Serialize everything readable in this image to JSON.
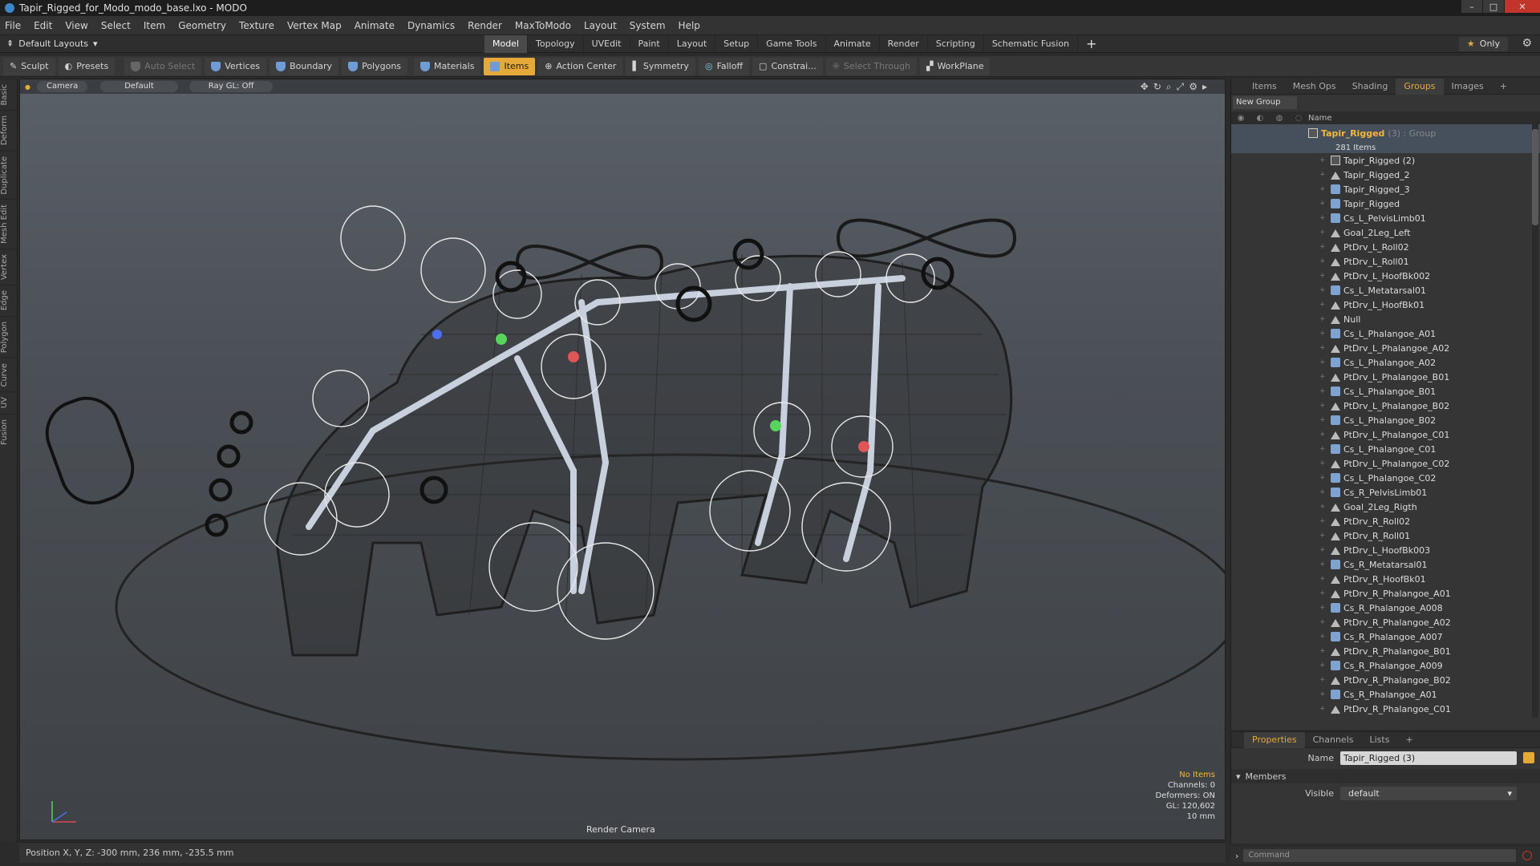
{
  "window": {
    "title": "Tapir_Rigged_for_Modo_modo_base.lxo - MODO",
    "controls": [
      "–",
      "□",
      "✕"
    ]
  },
  "menu": [
    "File",
    "Edit",
    "View",
    "Select",
    "Item",
    "Geometry",
    "Texture",
    "Vertex Map",
    "Animate",
    "Dynamics",
    "Render",
    "MaxToModo",
    "Layout",
    "System",
    "Help"
  ],
  "layoutbar": {
    "layouts_label": "Default Layouts",
    "tabs": [
      "Model",
      "Topology",
      "UVEdit",
      "Paint",
      "Layout",
      "Setup",
      "Game Tools",
      "Animate",
      "Render",
      "Scripting",
      "Schematic Fusion"
    ],
    "active_tab": "Model",
    "plus": "+",
    "only_label": "Only"
  },
  "toolbar": {
    "sculpt": "Sculpt",
    "presets": "Presets",
    "auto_select": "Auto Select",
    "vertices": "Vertices",
    "boundary": "Boundary",
    "polygons": "Polygons",
    "materials": "Materials",
    "items": "Items",
    "action_center": "Action Center",
    "symmetry": "Symmetry",
    "falloff": "Falloff",
    "constrain": "Constrai...",
    "select_through": "Select Through",
    "workplane": "WorkPlane"
  },
  "left_tabs": [
    "Basic",
    "Deform",
    "Duplicate",
    "Mesh Edit",
    "Vertex",
    "Edge",
    "Polygon",
    "Curve",
    "UV",
    "Fusion"
  ],
  "viewport": {
    "camera": "Camera",
    "shading": "Default",
    "raygl": "Ray GL: Off",
    "info": {
      "selection": "No Items",
      "channels": "Channels: 0",
      "deformers": "Deformers: ON",
      "gl": "GL: 120,602",
      "scale": "10 mm"
    },
    "render_camera": "Render Camera"
  },
  "status": {
    "position": "Position X, Y, Z:  -300 mm, 236 mm, -235.5 mm"
  },
  "right_panel": {
    "tabs": [
      "Items",
      "Mesh Ops",
      "Shading",
      "Groups",
      "Images"
    ],
    "active_tab": "Groups",
    "plus": "+",
    "new_group": "New Group",
    "column_name": "Name",
    "group": {
      "name": "Tapir_Rigged",
      "suffix": "(3) : Group",
      "count": "281 Items"
    },
    "items": [
      {
        "name": "Tapir_Rigged (2)",
        "type": "group"
      },
      {
        "name": "Tapir_Rigged_2",
        "type": "locator"
      },
      {
        "name": "Tapir_Rigged_3",
        "type": "mesh"
      },
      {
        "name": "Tapir_Rigged",
        "type": "mesh"
      },
      {
        "name": "Cs_L_PelvisLimb01",
        "type": "mesh"
      },
      {
        "name": "Goal_2Leg_Left",
        "type": "locator"
      },
      {
        "name": "PtDrv_L_Roll02",
        "type": "locator"
      },
      {
        "name": "PtDrv_L_Roll01",
        "type": "locator"
      },
      {
        "name": "PtDrv_L_HoofBk002",
        "type": "locator"
      },
      {
        "name": "Cs_L_Metatarsal01",
        "type": "mesh"
      },
      {
        "name": "PtDrv_L_HoofBk01",
        "type": "locator"
      },
      {
        "name": "Null",
        "type": "locator"
      },
      {
        "name": "Cs_L_Phalangoe_A01",
        "type": "mesh"
      },
      {
        "name": "PtDrv_L_Phalangoe_A02",
        "type": "locator"
      },
      {
        "name": "Cs_L_Phalangoe_A02",
        "type": "mesh"
      },
      {
        "name": "PtDrv_L_Phalangoe_B01",
        "type": "locator"
      },
      {
        "name": "Cs_L_Phalangoe_B01",
        "type": "mesh"
      },
      {
        "name": "PtDrv_L_Phalangoe_B02",
        "type": "locator"
      },
      {
        "name": "Cs_L_Phalangoe_B02",
        "type": "mesh"
      },
      {
        "name": "PtDrv_L_Phalangoe_C01",
        "type": "locator"
      },
      {
        "name": "Cs_L_Phalangoe_C01",
        "type": "mesh"
      },
      {
        "name": "PtDrv_L_Phalangoe_C02",
        "type": "locator"
      },
      {
        "name": "Cs_L_Phalangoe_C02",
        "type": "mesh"
      },
      {
        "name": "Cs_R_PelvisLimb01",
        "type": "mesh"
      },
      {
        "name": "Goal_2Leg_Rigth",
        "type": "locator"
      },
      {
        "name": "PtDrv_R_Roll02",
        "type": "locator"
      },
      {
        "name": "PtDrv_R_Roll01",
        "type": "locator"
      },
      {
        "name": "PtDrv_L_HoofBk003",
        "type": "locator"
      },
      {
        "name": "Cs_R_Metatarsal01",
        "type": "mesh"
      },
      {
        "name": "PtDrv_R_HoofBk01",
        "type": "locator"
      },
      {
        "name": "PtDrv_R_Phalangoe_A01",
        "type": "locator"
      },
      {
        "name": "Cs_R_Phalangoe_A008",
        "type": "mesh"
      },
      {
        "name": "PtDrv_R_Phalangoe_A02",
        "type": "locator"
      },
      {
        "name": "Cs_R_Phalangoe_A007",
        "type": "mesh"
      },
      {
        "name": "PtDrv_R_Phalangoe_B01",
        "type": "locator"
      },
      {
        "name": "Cs_R_Phalangoe_A009",
        "type": "mesh"
      },
      {
        "name": "PtDrv_R_Phalangoe_B02",
        "type": "locator"
      },
      {
        "name": "Cs_R_Phalangoe_A01",
        "type": "mesh"
      },
      {
        "name": "PtDrv_R_Phalangoe_C01",
        "type": "locator"
      }
    ]
  },
  "properties": {
    "tabs": [
      "Properties",
      "Channels",
      "Lists"
    ],
    "active_tab": "Properties",
    "plus": "+",
    "name_label": "Name",
    "name_value": "Tapir_Rigged (3)",
    "members_label": "Members",
    "visible_label": "Visible",
    "visible_value": "default"
  },
  "command": {
    "placeholder": "Command"
  },
  "colors": {
    "accent": "#e5a93a",
    "group_highlight": "#46505c",
    "close_red": "#c2352a"
  }
}
